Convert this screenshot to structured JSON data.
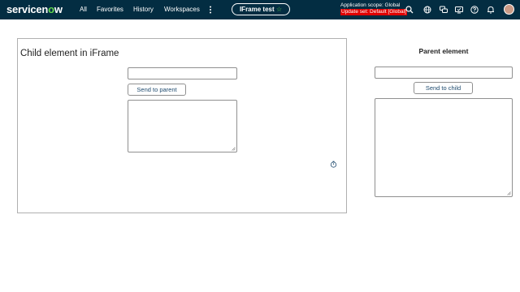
{
  "header": {
    "logo": "servicenow",
    "nav": [
      "All",
      "Favorites",
      "History",
      "Workspaces"
    ],
    "more_icon": "more-vertical-icon",
    "context_pill": {
      "label": "IFrame test",
      "icon": "star-icon"
    },
    "scope": {
      "line1": "Application scope: Global",
      "line2": "Update set: Default [Global]"
    },
    "icons": [
      "search-icon",
      "globe-icon",
      "chat-icon",
      "screen-icon",
      "help-icon",
      "bell-icon",
      "avatar"
    ]
  },
  "child": {
    "title": "Child element in iFrame",
    "input_value": "",
    "button_label": "Send to parent",
    "textarea_value": ""
  },
  "parent": {
    "title": "Parent element",
    "input_value": "",
    "button_label": "Send to child",
    "textarea_value": ""
  },
  "colors": {
    "header_bg": "#032d42",
    "brand_green": "#62d84e",
    "update_set_bg": "#e00000"
  }
}
